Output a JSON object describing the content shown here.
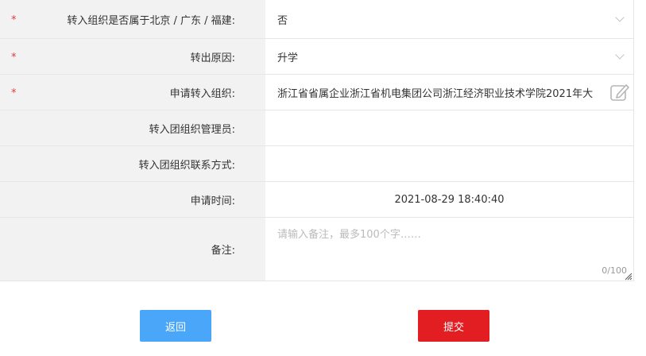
{
  "form": {
    "rows": [
      {
        "label": "转入组织是否属于北京 / 广东 / 福建:",
        "required": "*",
        "value": "否"
      },
      {
        "label": "转出原因:",
        "required": "*",
        "value": "升学"
      },
      {
        "label": "申请转入组织:",
        "required": "*",
        "value": "浙江省省属企业浙江省机电集团公司浙江经济职业技术学院2021年大"
      },
      {
        "label": "转入团组织管理员:",
        "value": ""
      },
      {
        "label": "转入团组织联系方式:",
        "value": ""
      },
      {
        "label": "申请时间:",
        "value": "2021-08-29 18:40:40"
      },
      {
        "label": "备注:",
        "value": "",
        "placeholder": "请输入备注，最多100个字……",
        "counter": "0/100"
      }
    ]
  },
  "buttons": {
    "back": "返回",
    "submit": "提交"
  },
  "colors": {
    "required": "#e4393c",
    "back": "#4aa6f8",
    "submit": "#e21e23",
    "label_bg": "#f2f2f2"
  }
}
